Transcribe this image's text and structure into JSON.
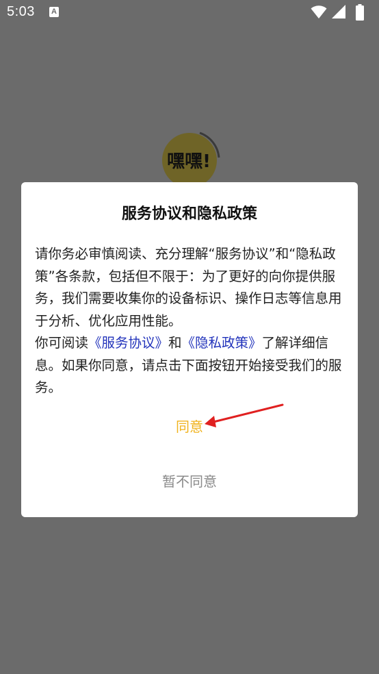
{
  "status_bar": {
    "time": "5:03",
    "notification_glyph": "A",
    "icons": [
      "wifi-icon",
      "signal-icon",
      "battery-icon"
    ]
  },
  "splash": {
    "logo_text": "嘿嘿!"
  },
  "dialog": {
    "title": "服务协议和隐私政策",
    "paragraph1": "请你务必审慎阅读、充分理解“服务协议”和“隐私政策”各条款，包括但不限于：为了更好的向你提供服务，我们需要收集你的设备标识、操作日志等信息用于分析、优化应用性能。",
    "p2_prefix": "你可阅读",
    "link_service": "《服务协议》",
    "p2_and": "和",
    "link_privacy": "《隐私政策》",
    "p2_suffix": "了解详细信息。如果你同意，请点击下面按钮开始接受我们的服务。",
    "agree_label": "同意",
    "disagree_label": "暂不同意"
  },
  "colors": {
    "overlay_bg": "#6b6b6b",
    "agree": "#f0b21c",
    "disagree": "#8a8a8a",
    "link": "#2233bb",
    "annotation_arrow": "#e02020"
  }
}
